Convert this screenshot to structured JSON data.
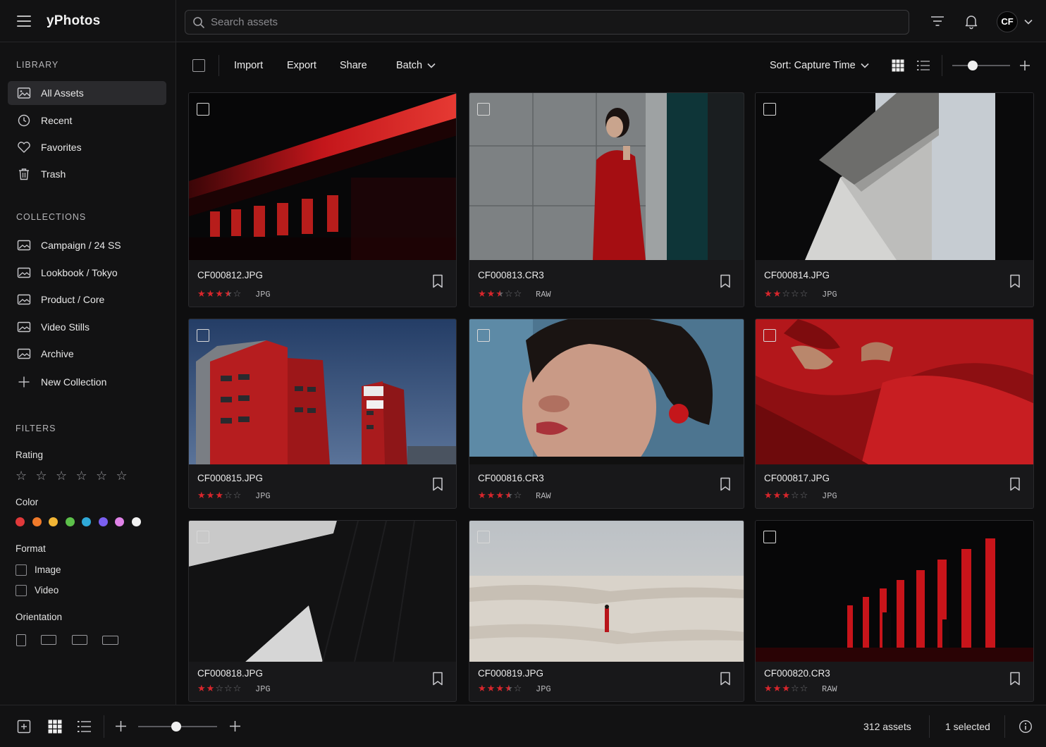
{
  "app": {
    "title": "yPhotos"
  },
  "search": {
    "placeholder": "Search assets"
  },
  "user": {
    "initials": "CF"
  },
  "sidebar": {
    "library_title": "LIBRARY",
    "library": [
      {
        "label": "All Assets",
        "icon": "photo-icon",
        "active": true
      },
      {
        "label": "Recent",
        "icon": "clock-icon"
      },
      {
        "label": "Favorites",
        "icon": "heart-icon"
      },
      {
        "label": "Trash",
        "icon": "trash-icon"
      }
    ],
    "collections_title": "COLLECTIONS",
    "collections": [
      {
        "label": "Campaign / 24 SS",
        "icon": "collection-icon"
      },
      {
        "label": "Lookbook / Tokyo",
        "icon": "collection-icon"
      },
      {
        "label": "Product / Core",
        "icon": "collection-icon"
      },
      {
        "label": "Video Stills",
        "icon": "collection-icon"
      },
      {
        "label": "Archive",
        "icon": "collection-icon"
      }
    ],
    "new_collection": "New Collection",
    "filters_title": "FILTERS",
    "rating_label": "Rating",
    "color_label": "Color",
    "colors": [
      "#e0393a",
      "#f07a2a",
      "#f2b535",
      "#5cc04a",
      "#2fa9d8",
      "#7a5ff0",
      "#e083e8",
      "#f2f2f2"
    ],
    "format_label": "Format",
    "formats": [
      "Image",
      "Video"
    ],
    "orientation_label": "Orientation"
  },
  "toolbar": {
    "import": "Import",
    "export": "Export",
    "share": "Share",
    "batch": "Batch",
    "sort": "Sort: Capture Time"
  },
  "assets": [
    {
      "name": "CF000812.JPG",
      "rating": 3.5,
      "format": "JPG"
    },
    {
      "name": "CF000813.CR3",
      "rating": 2.5,
      "format": "RAW"
    },
    {
      "name": "CF000814.JPG",
      "rating": 2,
      "format": "JPG"
    },
    {
      "name": "CF000815.JPG",
      "rating": 3,
      "format": "JPG"
    },
    {
      "name": "CF000816.CR3",
      "rating": 3.5,
      "format": "RAW"
    },
    {
      "name": "CF000817.JPG",
      "rating": 3,
      "format": "JPG"
    },
    {
      "name": "CF000818.JPG",
      "rating": 2,
      "format": "JPG"
    },
    {
      "name": "CF000819.JPG",
      "rating": 3.5,
      "format": "JPG"
    },
    {
      "name": "CF000820.CR3",
      "rating": 3,
      "format": "RAW"
    }
  ],
  "status": {
    "count": "312 assets",
    "selected": "1 selected"
  }
}
